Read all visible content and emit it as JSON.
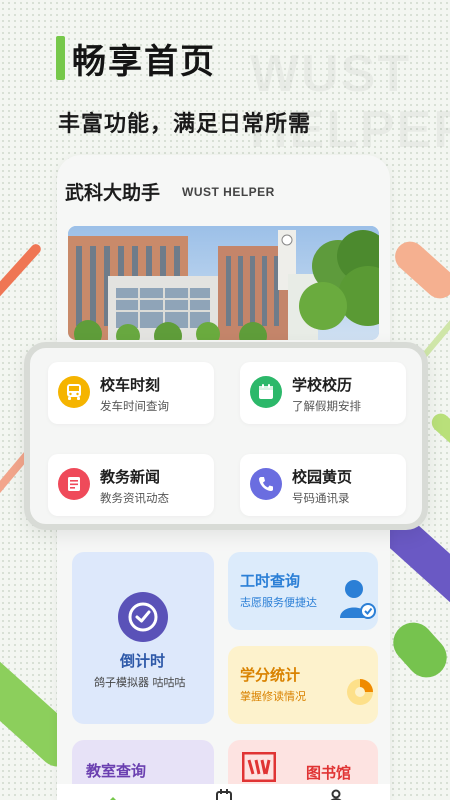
{
  "header": {
    "title": "畅享首页",
    "subtitle": "丰富功能，满足日常所需",
    "watermark_line1": "WUST",
    "watermark_line2": "HELPER"
  },
  "app": {
    "name": "武科大助手",
    "name_en": "WUST HELPER"
  },
  "quick_tiles": [
    {
      "title": "校车时刻",
      "desc": "发车时间查询",
      "icon": "bus-icon",
      "color": "#f5b400"
    },
    {
      "title": "学校校历",
      "desc": "了解假期安排",
      "icon": "calendar-icon",
      "color": "#2cb86a"
    },
    {
      "title": "教务新闻",
      "desc": "教务资讯动态",
      "icon": "news-icon",
      "color": "#ef4a5a"
    },
    {
      "title": "校园黄页",
      "desc": "号码通讯录",
      "icon": "phone-icon",
      "color": "#6a6de0"
    }
  ],
  "cards": {
    "countdown": {
      "title": "倒计时",
      "desc": "鸽子模拟器 咕咕咕",
      "icon": "clock-icon",
      "color": "#2d58a8"
    },
    "work_hours": {
      "title": "工时查询",
      "desc": "志愿服务便捷达",
      "icon": "user-icon",
      "color": "#2b7fd6"
    },
    "credits": {
      "title": "学分统计",
      "desc": "掌握修读情况",
      "icon": "pie-chart-icon",
      "color": "#e08a00"
    },
    "classroom": {
      "title": "教室查询",
      "icon": "classroom-icon",
      "color": "#6a3fb0"
    },
    "library": {
      "title": "图书馆",
      "icon": "library-icon",
      "color": "#e03434"
    }
  },
  "colors": {
    "accent_green": "#76c84a",
    "background": "#f3f6f1"
  }
}
